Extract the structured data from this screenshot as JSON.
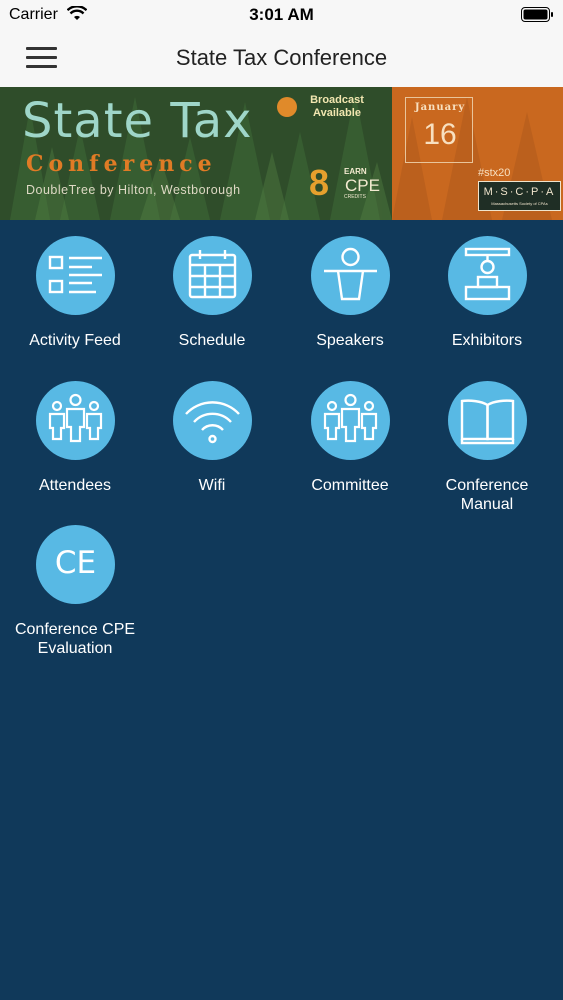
{
  "status_bar": {
    "carrier": "Carrier",
    "time": "3:01 AM"
  },
  "nav": {
    "title": "State Tax Conference",
    "menu_icon": "hamburger-menu-icon"
  },
  "banner": {
    "title": "State Tax",
    "subtitle": "Conference",
    "venue": "DoubleTree by Hilton, Westborough",
    "broadcast": "Broadcast Available",
    "cpe_number": "8",
    "cpe_earn": "EARN",
    "cpe_label": "CPE",
    "cpe_credits": "CREDITS",
    "month": "January",
    "day": "16",
    "hashtag": "#stx20",
    "org": "M·S·C·P·A",
    "org_sub": "Massachusetts Society of CPAs"
  },
  "menu": {
    "items": [
      {
        "label": "Activity Feed",
        "icon": "activity-feed-icon"
      },
      {
        "label": "Schedule",
        "icon": "calendar-icon"
      },
      {
        "label": "Speakers",
        "icon": "speaker-podium-icon"
      },
      {
        "label": "Exhibitors",
        "icon": "exhibitor-booth-icon"
      },
      {
        "label": "Attendees",
        "icon": "attendees-icon"
      },
      {
        "label": "Wifi",
        "icon": "wifi-icon"
      },
      {
        "label": "Committee",
        "icon": "committee-icon"
      },
      {
        "label": "Conference Manual",
        "icon": "book-icon"
      },
      {
        "label": "Conference CPE Evaluation",
        "icon": "ce-icon",
        "icon_text": "CE"
      }
    ]
  },
  "colors": {
    "background": "#10395a",
    "icon_circle": "#58b9e4",
    "nav_bar": "#f7f7f7"
  }
}
